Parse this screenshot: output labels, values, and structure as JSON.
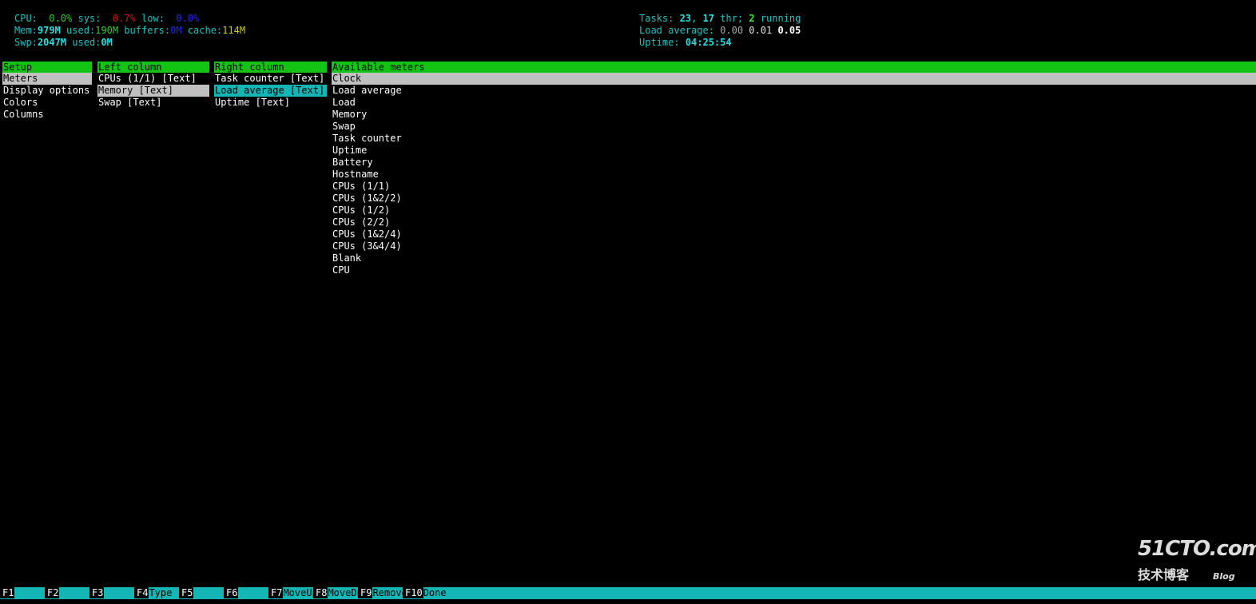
{
  "header_left": {
    "cpu": {
      "label": "CPU:",
      "cpu_val": "0.0%",
      "sys_label": "sys:",
      "sys_val": "0.7%",
      "low_label": "low:",
      "low_val": "0.0%"
    },
    "mem": {
      "label": "Mem:",
      "total": "979M",
      "used_label": "used:",
      "used_val": "190M",
      "buffers_label": "buffers:",
      "buffers_val": "0M",
      "cache_label": "cache:",
      "cache_val": "114M"
    },
    "swp": {
      "label": "Swp:",
      "total": "2047M",
      "used_label": "used:",
      "used_val": "0M"
    }
  },
  "header_right": {
    "tasks": {
      "label": "Tasks:",
      "count": "23",
      "sep": ",",
      "thr": "17",
      "thr_label": "thr;",
      "running": "2",
      "running_label": "running"
    },
    "load": {
      "label": "Load average:",
      "v1": "0.00",
      "v2": "0.01",
      "v3": "0.05"
    },
    "uptime": {
      "label": "Uptime:",
      "value": "04:25:54"
    }
  },
  "setup": {
    "title": "Setup",
    "items": [
      "Meters",
      "Display options",
      "Colors",
      "Columns"
    ]
  },
  "left_column": {
    "title": "Left column",
    "items": [
      "CPUs (1/1) [Text]",
      "Memory [Text]",
      "Swap [Text]"
    ]
  },
  "right_column": {
    "title": "Right column",
    "items": [
      "Task counter [Text]",
      "Load average [Text]",
      "Uptime [Text]"
    ]
  },
  "available_meters": {
    "title": "Available meters",
    "items": [
      "Clock",
      "Load average",
      "Load",
      "Memory",
      "Swap",
      "Task counter",
      "Uptime",
      "Battery",
      "Hostname",
      "CPUs (1/1)",
      "CPUs (1&2/2)",
      "CPUs (1/2)",
      "CPUs (2/2)",
      "CPUs (1&2/4)",
      "CPUs (3&4/4)",
      "Blank",
      "CPU"
    ]
  },
  "footer": {
    "keys": [
      {
        "key": "F1",
        "label": ""
      },
      {
        "key": "F2",
        "label": ""
      },
      {
        "key": "F3",
        "label": ""
      },
      {
        "key": "F4",
        "label": "Type"
      },
      {
        "key": "F5",
        "label": ""
      },
      {
        "key": "F6",
        "label": ""
      },
      {
        "key": "F7",
        "label": "MoveUp"
      },
      {
        "key": "F8",
        "label": "MoveDn"
      },
      {
        "key": "F9",
        "label": "Remove"
      },
      {
        "key": "F10",
        "label": "Done"
      }
    ]
  },
  "watermark": {
    "site": "51CTO.com",
    "subtitle": "技术博客",
    "blog": "Blog"
  },
  "colors": {
    "header_cyan": "#19c2c2",
    "panel_title_green": "#14c414",
    "selection_grey": "#c0c0c0",
    "selection_cyan": "#13b5b5",
    "footer_bar": "#13b5b5",
    "background": "#000000"
  }
}
